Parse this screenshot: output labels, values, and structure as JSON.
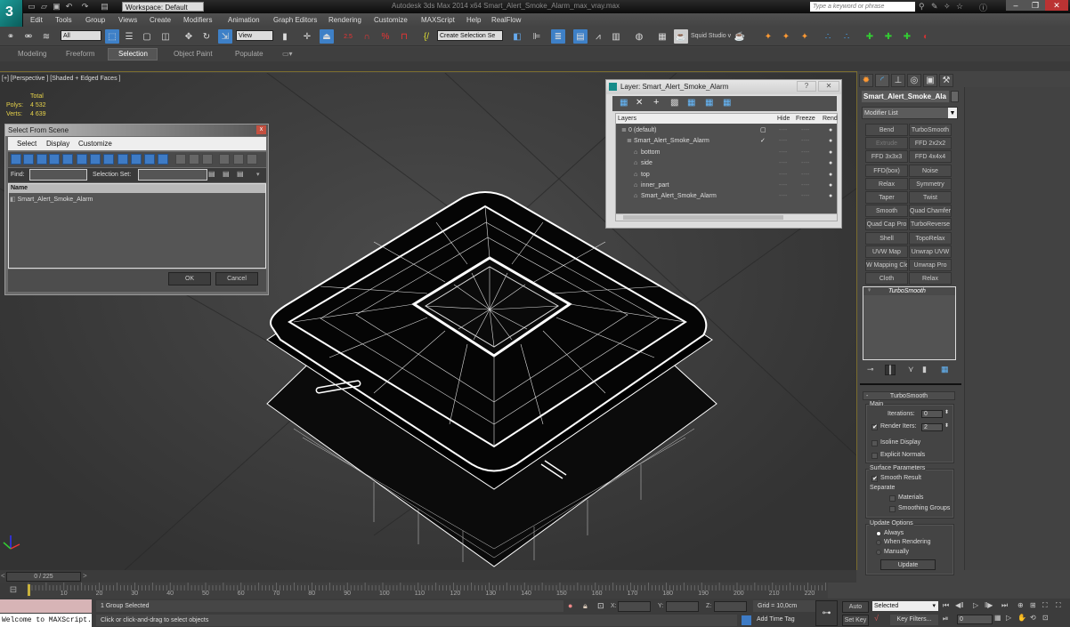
{
  "titlebar": {
    "workspace": "Workspace: Default",
    "title": "Autodesk 3ds Max  2014 x64     Smart_Alert_Smoke_Alarm_max_vray.max",
    "search_placeholder": "Type a keyword or phrase"
  },
  "menu": [
    "Edit",
    "Tools",
    "Group",
    "Views",
    "Create",
    "Modifiers",
    "Animation",
    "Graph Editors",
    "Rendering",
    "Customize",
    "MAXScript",
    "Help",
    "RealFlow"
  ],
  "toolbar": {
    "selection_filter": "All",
    "ref_coord": "View",
    "named_selection": "Create Selection Se",
    "snap_value": "2.5",
    "renderer_label": "Squid Studio v"
  },
  "ribbon": {
    "tabs": [
      "Modeling",
      "Freeform",
      "Selection",
      "Object Paint",
      "Populate"
    ],
    "active": "Selection"
  },
  "viewport": {
    "label": "[+] [Perspective ] [Shaded + Edged Faces ]",
    "stats": {
      "header": "Total",
      "polys_label": "Polys:",
      "polys": "4 532",
      "verts_label": "Verts:",
      "verts": "4 639"
    }
  },
  "select_from_scene": {
    "title": "Select From Scene",
    "menu": [
      "Select",
      "Display",
      "Customize"
    ],
    "find_label": "Find:",
    "selection_set_label": "Selection Set:",
    "column_name": "Name",
    "items": [
      "Smart_Alert_Smoke_Alarm"
    ],
    "ok": "OK",
    "cancel": "Cancel"
  },
  "layer_dialog": {
    "title": "Layer: Smart_Alert_Smoke_Alarm",
    "columns": [
      "Layers",
      "Hide",
      "Freeze",
      "Rend"
    ],
    "rows": [
      {
        "name": "0 (default)",
        "indent": 1,
        "current": "box"
      },
      {
        "name": "Smart_Alert_Smoke_Alarm",
        "indent": 0,
        "current": "check"
      },
      {
        "name": "bottom",
        "indent": 2,
        "current": ""
      },
      {
        "name": "side",
        "indent": 2,
        "current": ""
      },
      {
        "name": "top",
        "indent": 2,
        "current": ""
      },
      {
        "name": "inner_part",
        "indent": 2,
        "current": ""
      },
      {
        "name": "Smart_Alert_Smoke_Alarm",
        "indent": 2,
        "current": ""
      }
    ],
    "dash": "----",
    "scroll_thumb": "III"
  },
  "command_panel": {
    "object_name": "Smart_Alert_Smoke_Ala",
    "modifier_list": "Modifier List",
    "modifiers": [
      [
        "Bend",
        "TurboSmooth"
      ],
      [
        "Extrude",
        "FFD 2x2x2"
      ],
      [
        "FFD 3x3x3",
        "FFD 4x4x4"
      ],
      [
        "FFD(box)",
        "Noise"
      ],
      [
        "Relax",
        "Symmetry"
      ],
      [
        "Taper",
        "Twist"
      ],
      [
        "Smooth",
        "Quad Chamfer"
      ],
      [
        "Quad Cap Pro",
        "TurboReverse"
      ],
      [
        "Shell",
        "TopoRelax"
      ],
      [
        "UVW Map",
        "Unwrap UVW"
      ],
      [
        "W Mapping Cle",
        "Unwrap Pro"
      ],
      [
        "Cloth",
        "Relax"
      ]
    ],
    "stack": [
      "TurboSmooth"
    ],
    "rollout": {
      "title": "TurboSmooth",
      "main_label": "Main",
      "iterations_label": "Iterations:",
      "iterations": "0",
      "render_iters_label": "Render Iters:",
      "render_iters": "2",
      "render_iters_checked": true,
      "isoline_label": "Isoline Display",
      "explicit_label": "Explicit Normals",
      "surface_label": "Surface Parameters",
      "smooth_result_label": "Smooth Result",
      "smooth_result_checked": true,
      "separate_label": "Separate",
      "materials_label": "Materials",
      "smoothing_groups_label": "Smoothing Groups",
      "update_options_label": "Update Options",
      "always_label": "Always",
      "when_rendering_label": "When Rendering",
      "manually_label": "Manually",
      "update_mode": "Always",
      "update_button": "Update"
    }
  },
  "timeline": {
    "slider": "0 / 225",
    "ticks": [
      "10",
      "20",
      "30",
      "40",
      "50",
      "60",
      "70",
      "80",
      "90",
      "100",
      "110",
      "120",
      "130",
      "140",
      "150",
      "160",
      "170",
      "180",
      "190",
      "200",
      "210",
      "220"
    ]
  },
  "status": {
    "maxscript_output": "Welcome to MAXScript.",
    "selection": "1 Group Selected",
    "prompt": "Click or click-and-drag to select objects",
    "x_label": "X:",
    "y_label": "Y:",
    "z_label": "Z:",
    "grid": "Grid = 10,0cm",
    "add_time_tag": "Add Time Tag",
    "auto_key": "Auto Key",
    "set_key": "Set Key",
    "key_mode": "Selected",
    "key_filters": "Key Filters...",
    "current_frame": "0"
  }
}
